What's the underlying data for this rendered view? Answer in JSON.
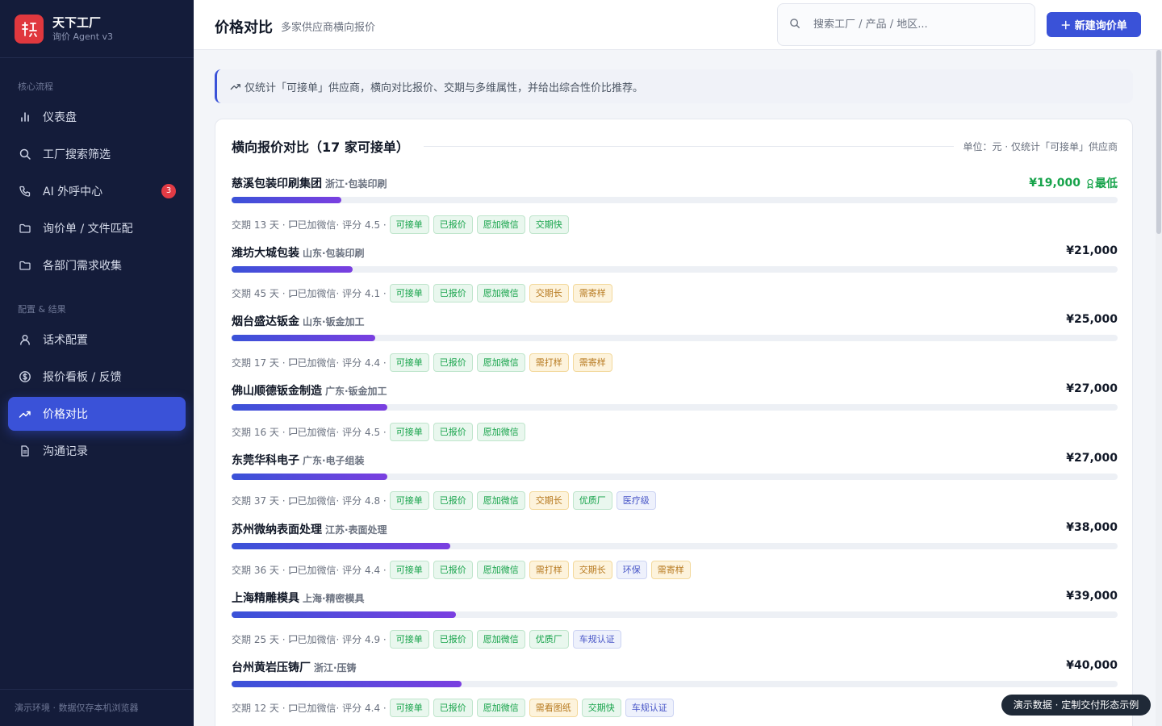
{
  "brand": {
    "name": "天下工厂",
    "subtitle": "询价 Agent v3",
    "logo_text": "许"
  },
  "sidebar": {
    "section_core": "核心流程",
    "section_config": "配置 & 结果",
    "items": [
      {
        "label": "仪表盘",
        "icon": "bar-chart-icon"
      },
      {
        "label": "工厂搜索筛选",
        "icon": "search-icon"
      },
      {
        "label": "AI 外呼中心",
        "icon": "phone-icon",
        "badge": "3"
      },
      {
        "label": "询价单 / 文件匹配",
        "icon": "folder-icon"
      },
      {
        "label": "各部门需求收集",
        "icon": "folder-icon"
      },
      {
        "label": "话术配置",
        "icon": "user-icon"
      },
      {
        "label": "报价看板 / 反馈",
        "icon": "dollar-icon"
      },
      {
        "label": "价格对比",
        "icon": "trend-icon",
        "active": true
      },
      {
        "label": "沟通记录",
        "icon": "document-icon"
      }
    ],
    "footer": "演示环境 · 数据仅存本机浏览器"
  },
  "header": {
    "title": "价格对比",
    "subtitle": "多家供应商横向报价",
    "search_placeholder": "搜索工厂 / 产品 / 地区...",
    "new_button": "＋ 新建询价单"
  },
  "notice": "仅统计「可接单」供应商，横向对比报价、交期与多维属性，并给出综合性价比推荐。",
  "card": {
    "title": "横向报价对比（17 家可接单）",
    "unit": "单位：元 · 仅统计「可接单」供应商",
    "lowest_label": "最低",
    "wechat_label": "已加微信",
    "rows": [
      {
        "name": "慈溪包装印刷集团",
        "region": "浙江·包装印刷",
        "price": "¥19,000",
        "price_value": 19000,
        "lead_time": "交期 13 天 ·",
        "rating": "· 评分 4.5 ·",
        "lowest": true,
        "tags": [
          {
            "label": "可接单",
            "tone": "green"
          },
          {
            "label": "已报价",
            "tone": "green"
          },
          {
            "label": "愿加微信",
            "tone": "green"
          },
          {
            "label": "交期快",
            "tone": "green"
          }
        ]
      },
      {
        "name": "潍坊大城包装",
        "region": "山东·包装印刷",
        "price": "¥21,000",
        "price_value": 21000,
        "lead_time": "交期 45 天 ·",
        "rating": "· 评分 4.1 ·",
        "tags": [
          {
            "label": "可接单",
            "tone": "green"
          },
          {
            "label": "已报价",
            "tone": "green"
          },
          {
            "label": "愿加微信",
            "tone": "green"
          },
          {
            "label": "交期长",
            "tone": "orange"
          },
          {
            "label": "需寄样",
            "tone": "orange"
          }
        ]
      },
      {
        "name": "烟台盛达钣金",
        "region": "山东·钣金加工",
        "price": "¥25,000",
        "price_value": 25000,
        "lead_time": "交期 17 天 ·",
        "rating": "· 评分 4.4 ·",
        "tags": [
          {
            "label": "可接单",
            "tone": "green"
          },
          {
            "label": "已报价",
            "tone": "green"
          },
          {
            "label": "愿加微信",
            "tone": "green"
          },
          {
            "label": "需打样",
            "tone": "orange"
          },
          {
            "label": "需寄样",
            "tone": "orange"
          }
        ]
      },
      {
        "name": "佛山顺德钣金制造",
        "region": "广东·钣金加工",
        "price": "¥27,000",
        "price_value": 27000,
        "lead_time": "交期 16 天 ·",
        "rating": "· 评分 4.5 ·",
        "tags": [
          {
            "label": "可接单",
            "tone": "green"
          },
          {
            "label": "已报价",
            "tone": "green"
          },
          {
            "label": "愿加微信",
            "tone": "green"
          }
        ]
      },
      {
        "name": "东莞华科电子",
        "region": "广东·电子组装",
        "price": "¥27,000",
        "price_value": 27000,
        "lead_time": "交期 37 天 ·",
        "rating": "· 评分 4.8 ·",
        "tags": [
          {
            "label": "可接单",
            "tone": "green"
          },
          {
            "label": "已报价",
            "tone": "green"
          },
          {
            "label": "愿加微信",
            "tone": "green"
          },
          {
            "label": "交期长",
            "tone": "orange"
          },
          {
            "label": "优质厂",
            "tone": "green"
          },
          {
            "label": "医疗级",
            "tone": "blue"
          }
        ]
      },
      {
        "name": "苏州微纳表面处理",
        "region": "江苏·表面处理",
        "price": "¥38,000",
        "price_value": 38000,
        "lead_time": "交期 36 天 ·",
        "rating": "· 评分 4.4 ·",
        "tags": [
          {
            "label": "可接单",
            "tone": "green"
          },
          {
            "label": "已报价",
            "tone": "green"
          },
          {
            "label": "愿加微信",
            "tone": "green"
          },
          {
            "label": "需打样",
            "tone": "orange"
          },
          {
            "label": "交期长",
            "tone": "orange"
          },
          {
            "label": "环保",
            "tone": "blue"
          },
          {
            "label": "需寄样",
            "tone": "orange"
          }
        ]
      },
      {
        "name": "上海精雕模具",
        "region": "上海·精密模具",
        "price": "¥39,000",
        "price_value": 39000,
        "lead_time": "交期 25 天 ·",
        "rating": "· 评分 4.9 ·",
        "tags": [
          {
            "label": "可接单",
            "tone": "green"
          },
          {
            "label": "已报价",
            "tone": "green"
          },
          {
            "label": "愿加微信",
            "tone": "green"
          },
          {
            "label": "优质厂",
            "tone": "green"
          },
          {
            "label": "车规认证",
            "tone": "blue"
          }
        ]
      },
      {
        "name": "台州黄岩压铸厂",
        "region": "浙江·压铸",
        "price": "¥40,000",
        "price_value": 40000,
        "lead_time": "交期 12 天 ·",
        "rating": "· 评分 4.4 ·",
        "tags": [
          {
            "label": "可接单",
            "tone": "green"
          },
          {
            "label": "已报价",
            "tone": "green"
          },
          {
            "label": "愿加微信",
            "tone": "green"
          },
          {
            "label": "需看图纸",
            "tone": "orange"
          },
          {
            "label": "交期快",
            "tone": "green"
          },
          {
            "label": "车规认证",
            "tone": "blue"
          }
        ]
      }
    ]
  },
  "toast": "演示数据 · 定制交付形态示例",
  "colors": {
    "accent": "#3a52d8",
    "sidebar_bg": "#141c3a",
    "lowest": "#16a34a",
    "bar_end": "#7a3fe0"
  }
}
